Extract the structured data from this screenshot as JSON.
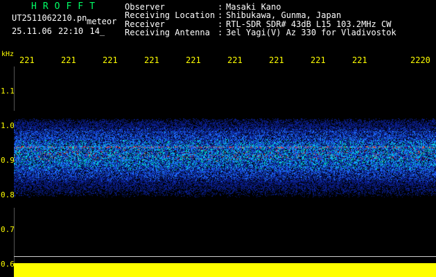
{
  "header": {
    "app_title": "HROFFT",
    "filename": "UT2511062210.pn",
    "tag": "meteor",
    "datetime": "25.11.06 22:10   14_"
  },
  "info": [
    {
      "label": "Observer",
      "value": "Masaki Kano"
    },
    {
      "label": "Receiving Location",
      "value": "Shibukawa, Gunma, Japan"
    },
    {
      "label": "Receiver",
      "value": "RTL-SDR SDR# 43dB L15 103.2MHz CW"
    },
    {
      "label": "Receiving Antenna",
      "value": "3el Yagi(V) Az 330 for Vladivostok"
    }
  ],
  "axis": {
    "unit": "kHz",
    "time_ticks": [
      "221",
      "221",
      "221",
      "221",
      "221",
      "221",
      "221",
      "221",
      "221",
      "2220"
    ],
    "freq_ticks": [
      "1.1",
      "1.0",
      "0.9",
      "0.8",
      "0.7",
      "0.6"
    ]
  },
  "colors": {
    "background": "#000000",
    "title": "#00ff66",
    "text": "#ffffff",
    "axis": "#ffff00",
    "signal_low": "#0a1e8c",
    "signal_mid": "#1e6eff",
    "signal_high": "#00e6d2",
    "signal_peak": "#ff3c28"
  }
}
